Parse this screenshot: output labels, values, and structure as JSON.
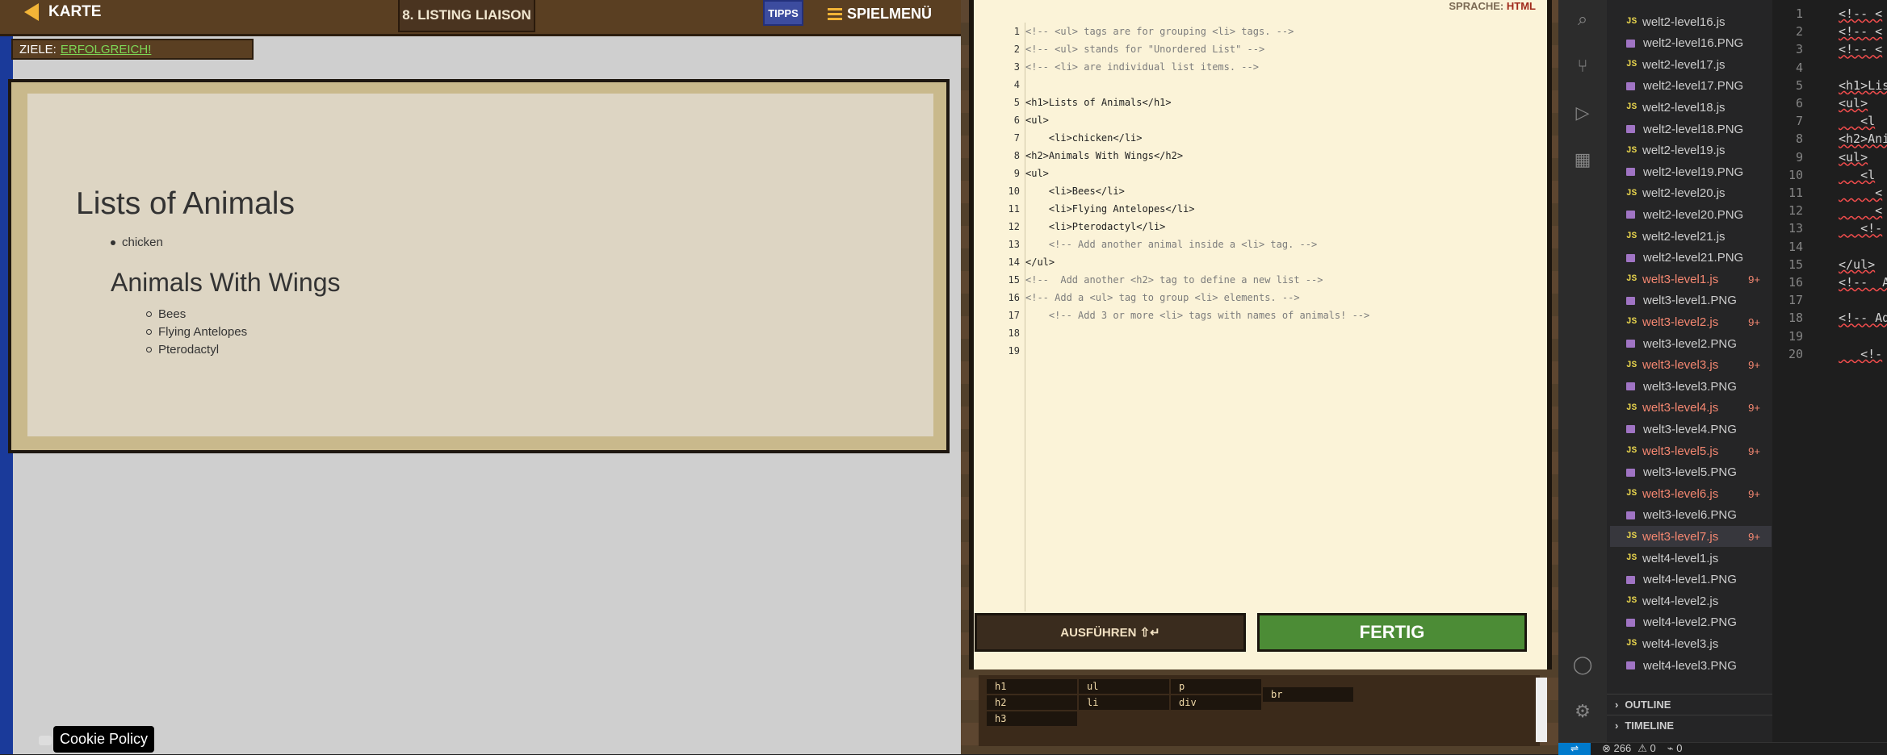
{
  "game": {
    "back_label": "KARTE",
    "level_title": "8. LISTING LIAISON",
    "tips_label": "TIPPS",
    "menu_label": "SPIELMENÜ",
    "goals_label": "ZIELE:",
    "goals_status": "ERFOLGREICH!",
    "cookie_label": "Cookie Policy",
    "render": {
      "h1": "Lists of Animals",
      "list1": [
        "chicken"
      ],
      "h2": "Animals With Wings",
      "list2": [
        "Bees",
        "Flying Antelopes",
        "Pterodactyl"
      ]
    }
  },
  "editor": {
    "language_label": "SPRACHE:",
    "language_value": "HTML",
    "lines": [
      {
        "n": "1",
        "text": "<!-- <ul> tags are for grouping <li> tags. -->",
        "comment": true
      },
      {
        "n": "2",
        "text": "<!-- <ul> stands for \"Unordered List\" -->",
        "comment": true
      },
      {
        "n": "3",
        "text": "<!-- <li> are individual list items. -->",
        "comment": true
      },
      {
        "n": "4",
        "text": "",
        "comment": false
      },
      {
        "n": "5",
        "text": "<h1>Lists of Animals</h1>",
        "comment": false
      },
      {
        "n": "6",
        "text": "<ul>",
        "comment": false
      },
      {
        "n": "7",
        "text": "    <li>chicken</li>",
        "comment": false
      },
      {
        "n": "8",
        "text": "<h2>Animals With Wings</h2>",
        "comment": false
      },
      {
        "n": "9",
        "text": "<ul>",
        "comment": false
      },
      {
        "n": "10",
        "text": "    <li>Bees</li>",
        "comment": false
      },
      {
        "n": "11",
        "text": "    <li>Flying Antelopes</li>",
        "comment": false
      },
      {
        "n": "12",
        "text": "    <li>Pterodactyl</li>",
        "comment": false
      },
      {
        "n": "13",
        "text": "    <!-- Add another animal inside a <li> tag. -->",
        "comment": true
      },
      {
        "n": "14",
        "text": "</ul>",
        "comment": false
      },
      {
        "n": "15",
        "text": "<!--  Add another <h2> tag to define a new list -->",
        "comment": true
      },
      {
        "n": "16",
        "text": "<!-- Add a <ul> tag to group <li> elements. -->",
        "comment": true
      },
      {
        "n": "17",
        "text": "    <!-- Add 3 or more <li> tags with names of animals! -->",
        "comment": true
      },
      {
        "n": "18",
        "text": "",
        "comment": false
      },
      {
        "n": "19",
        "text": "",
        "comment": false
      }
    ],
    "run_label": "AUSFÜHREN ⇧↵",
    "done_label": "FERTIG",
    "snippets": [
      "h1",
      "h2",
      "h3",
      "ul",
      "li",
      "p",
      "div",
      "br"
    ]
  },
  "explorer": {
    "files": [
      {
        "name": "welt2-level16.js",
        "kind": "js",
        "error": false,
        "badge": ""
      },
      {
        "name": "welt2-level16.PNG",
        "kind": "img",
        "error": false,
        "badge": ""
      },
      {
        "name": "welt2-level17.js",
        "kind": "js",
        "error": false,
        "badge": ""
      },
      {
        "name": "welt2-level17.PNG",
        "kind": "img",
        "error": false,
        "badge": ""
      },
      {
        "name": "welt2-level18.js",
        "kind": "js",
        "error": false,
        "badge": ""
      },
      {
        "name": "welt2-level18.PNG",
        "kind": "img",
        "error": false,
        "badge": ""
      },
      {
        "name": "welt2-level19.js",
        "kind": "js",
        "error": false,
        "badge": ""
      },
      {
        "name": "welt2-level19.PNG",
        "kind": "img",
        "error": false,
        "badge": ""
      },
      {
        "name": "welt2-level20.js",
        "kind": "js",
        "error": false,
        "badge": ""
      },
      {
        "name": "welt2-level20.PNG",
        "kind": "img",
        "error": false,
        "badge": ""
      },
      {
        "name": "welt2-level21.js",
        "kind": "js",
        "error": false,
        "badge": ""
      },
      {
        "name": "welt2-level21.PNG",
        "kind": "img",
        "error": false,
        "badge": ""
      },
      {
        "name": "welt3-level1.js",
        "kind": "js",
        "error": true,
        "badge": "9+"
      },
      {
        "name": "welt3-level1.PNG",
        "kind": "img",
        "error": false,
        "badge": ""
      },
      {
        "name": "welt3-level2.js",
        "kind": "js",
        "error": true,
        "badge": "9+"
      },
      {
        "name": "welt3-level2.PNG",
        "kind": "img",
        "error": false,
        "badge": ""
      },
      {
        "name": "welt3-level3.js",
        "kind": "js",
        "error": true,
        "badge": "9+"
      },
      {
        "name": "welt3-level3.PNG",
        "kind": "img",
        "error": false,
        "badge": ""
      },
      {
        "name": "welt3-level4.js",
        "kind": "js",
        "error": true,
        "badge": "9+"
      },
      {
        "name": "welt3-level4.PNG",
        "kind": "img",
        "error": false,
        "badge": ""
      },
      {
        "name": "welt3-level5.js",
        "kind": "js",
        "error": true,
        "badge": "9+"
      },
      {
        "name": "welt3-level5.PNG",
        "kind": "img",
        "error": false,
        "badge": ""
      },
      {
        "name": "welt3-level6.js",
        "kind": "js",
        "error": true,
        "badge": "9+"
      },
      {
        "name": "welt3-level6.PNG",
        "kind": "img",
        "error": false,
        "badge": ""
      },
      {
        "name": "welt3-level7.js",
        "kind": "js",
        "error": true,
        "badge": "9+",
        "selected": true
      },
      {
        "name": "welt4-level1.js",
        "kind": "js",
        "error": false,
        "badge": ""
      },
      {
        "name": "welt4-level1.PNG",
        "kind": "img",
        "error": false,
        "badge": ""
      },
      {
        "name": "welt4-level2.js",
        "kind": "js",
        "error": false,
        "badge": ""
      },
      {
        "name": "welt4-level2.PNG",
        "kind": "img",
        "error": false,
        "badge": ""
      },
      {
        "name": "welt4-level3.js",
        "kind": "js",
        "error": false,
        "badge": ""
      },
      {
        "name": "welt4-level3.PNG",
        "kind": "img",
        "error": false,
        "badge": ""
      }
    ],
    "outline_label": "OUTLINE",
    "timeline_label": "TIMELINE"
  },
  "vseditor": {
    "line_numbers": [
      "1",
      "2",
      "3",
      "4",
      "5",
      "6",
      "7",
      "8",
      "9",
      "10",
      "11",
      "12",
      "13",
      "14",
      "15",
      "16",
      "17",
      "18",
      "19",
      "20"
    ],
    "visible_text": [
      "<!-- <",
      "<!-- <",
      "<!-- <",
      "",
      "<h1>Lis",
      "<ul>",
      "   <l",
      "<h2>Ani",
      "<ul>",
      "   <l",
      "     <",
      "     <",
      "   <!-",
      "",
      "</ul>",
      "<!--  A",
      "",
      "<!-- Ad",
      "",
      "   <!-"
    ]
  },
  "status": {
    "errors": "266",
    "warnings": "0",
    "ports": "0"
  }
}
